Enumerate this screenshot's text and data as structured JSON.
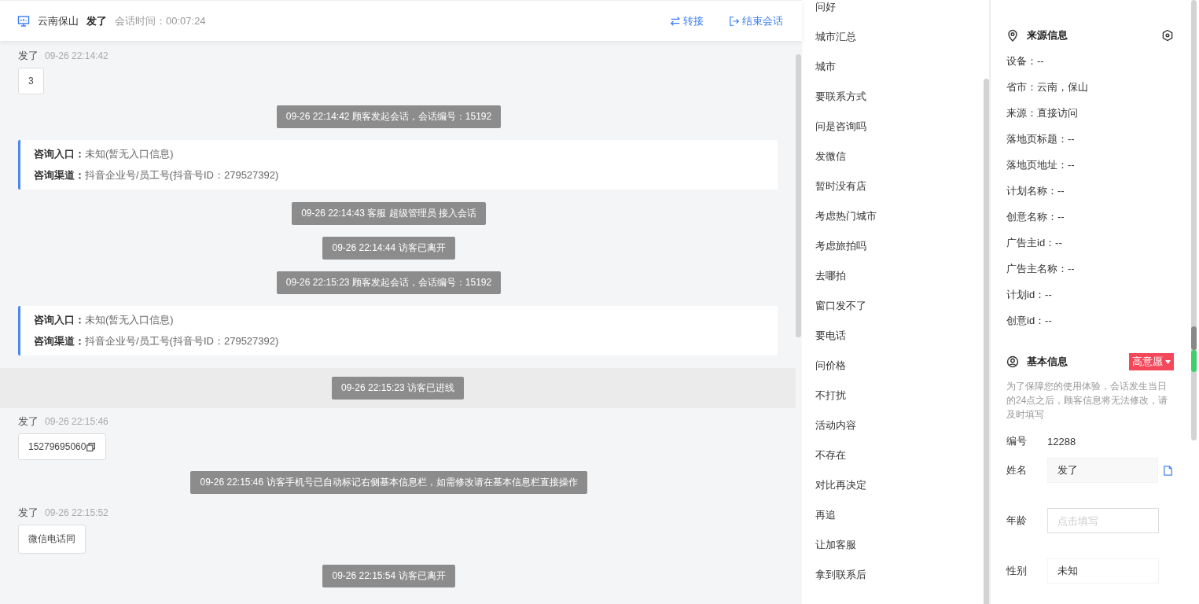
{
  "header": {
    "location": "云南保山",
    "visitor": "发了",
    "duration": "会话时间：00:07:24",
    "actions": [
      {
        "kind": "transfer",
        "label": "转接"
      },
      {
        "kind": "end",
        "label": "结束会话"
      }
    ]
  },
  "messages": [
    {
      "kind": "message",
      "sender": "发了",
      "time": "09-26 22:14:42",
      "content": "3",
      "copyable": false
    },
    {
      "kind": "system",
      "text": "09-26 22:14:42 顾客发起会话，会话编号：15192",
      "highlighted": false
    },
    {
      "kind": "info",
      "lines": [
        "**咨询入口：**未知(暂无入口信息)",
        "**咨询渠道：**抖音企业号/员工号(抖音号ID：279527392)"
      ]
    },
    {
      "kind": "system",
      "text": "09-26 22:14:43 客服 超级管理员 接入会话",
      "highlighted": false
    },
    {
      "kind": "system",
      "text": "09-26 22:14:44 访客已离开",
      "highlighted": false
    },
    {
      "kind": "system",
      "text": "09-26 22:15:23 顾客发起会话，会话编号：15192",
      "highlighted": false
    },
    {
      "kind": "info",
      "lines": [
        "**咨询入口：**未知(暂无入口信息)",
        "**咨询渠道：**抖音企业号/员工号(抖音号ID：279527392)"
      ]
    },
    {
      "kind": "system",
      "text": "09-26 22:15:23 访客已进线",
      "highlighted": true
    },
    {
      "kind": "message",
      "sender": "发了",
      "time": "09-26 22:15:46",
      "content": "15279695060",
      "copyable": true
    },
    {
      "kind": "system",
      "text": "09-26 22:15:46 访客手机号已自动标记右侧基本信息栏，如需修改请在基本信息栏直接操作",
      "highlighted": false
    },
    {
      "kind": "message",
      "sender": "发了",
      "time": "09-26 22:15:52",
      "content": "微信电话同",
      "copyable": false
    },
    {
      "kind": "system",
      "text": "09-26 22:15:54 访客已离开",
      "highlighted": false
    }
  ],
  "quick_replies": [
    "问好",
    "城市汇总",
    "城市",
    "要联系方式",
    "问是咨询吗",
    "发微信",
    "暂时没有店",
    "考虑热门城市",
    "考虑旅拍吗",
    "去哪拍",
    "窗口发不了",
    "要电话",
    "问价格",
    "不打扰",
    "活动内容",
    "不存在",
    "对比再决定",
    "再追",
    "让加客服",
    "拿到联系后"
  ],
  "source_info": {
    "title": "来源信息",
    "rows": [
      "设备：--",
      "省市：云南，保山",
      "来源：直接访问",
      "落地页标题：--",
      "落地页地址：--",
      "计划名称：--",
      "创意名称：--",
      "广告主id：--",
      "广告主名称：--",
      "计划id：--",
      "创意id：--"
    ]
  },
  "basic_info": {
    "title": "基本信息",
    "intent": "高意愿",
    "note": "为了保障您的使用体验，会话发生当日的24点之后，顾客信息将无法修改，请及时填写",
    "number_label": "编号",
    "number": "12288",
    "fields": [
      {
        "kind": "filled",
        "label": "姓名",
        "value": "发了"
      },
      {
        "kind": "input",
        "label": "年龄",
        "placeholder": "点击填写"
      },
      {
        "kind": "select",
        "label": "性别",
        "value": "未知"
      }
    ]
  }
}
